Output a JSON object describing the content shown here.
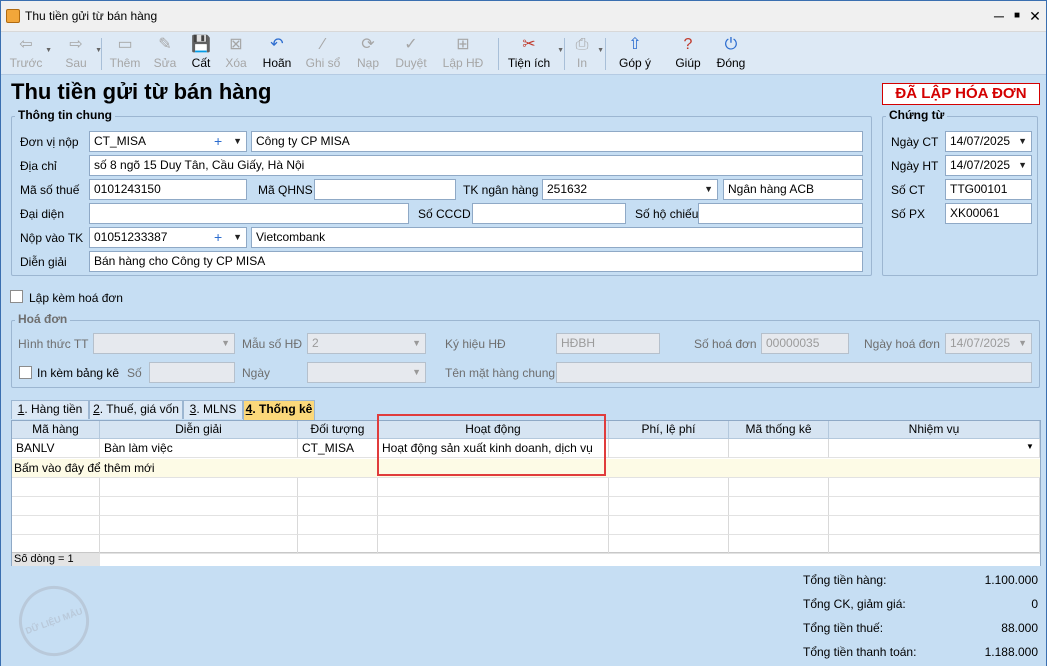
{
  "window": {
    "title": "Thu tiền gửi từ bán hàng",
    "min": "─",
    "max": "■",
    "close": "✕"
  },
  "toolbar": [
    {
      "label": "Trước",
      "icon": "⇦",
      "disabled": true,
      "dropdown": true
    },
    {
      "label": "Sau",
      "icon": "⇨",
      "disabled": true,
      "dropdown": true
    },
    {
      "label": "Thêm",
      "icon": "▭",
      "disabled": true
    },
    {
      "label": "Sửa",
      "icon": "✎",
      "disabled": true
    },
    {
      "label": "Cất",
      "icon": "💾",
      "disabled": false
    },
    {
      "label": "Xóa",
      "icon": "⊠",
      "disabled": true
    },
    {
      "label": "Hoãn",
      "icon": "↶",
      "disabled": false
    },
    {
      "label": "Ghi sổ",
      "icon": "∕",
      "disabled": true
    },
    {
      "label": "Nạp",
      "icon": "⟳",
      "disabled": true
    },
    {
      "label": "Duyệt",
      "icon": "✓",
      "disabled": true
    },
    {
      "label": "Lập HĐ",
      "icon": "⊞",
      "disabled": true
    },
    {
      "label": "Tiện ích",
      "icon": "✂",
      "disabled": false,
      "dropdown": true
    },
    {
      "label": "In",
      "icon": "⎙",
      "disabled": true,
      "dropdown": true
    },
    {
      "label": "Góp ý",
      "icon": "⇧",
      "disabled": false
    },
    {
      "label": "Giúp",
      "icon": "?",
      "disabled": false
    },
    {
      "label": "Đóng",
      "icon": "⏻",
      "disabled": false
    }
  ],
  "page": {
    "heading": "Thu tiền gửi từ bán hàng",
    "status_stamp": "ĐÃ LẬP HÓA ĐƠN"
  },
  "general": {
    "title": "Thông tin chung",
    "payer_label": "Đơn vị nộp",
    "payer_code": "CT_MISA",
    "payer_name": "Công ty CP MISA",
    "address_label": "Địa chỉ",
    "address": "số 8 ngõ 15 Duy Tân, Cầu Giấy, Hà Nội",
    "taxcode_label": "Mã số thuế",
    "taxcode": "0101243150",
    "qhns_label": "Mã QHNS",
    "qhns": "",
    "bankacc_label": "TK ngân hàng",
    "bankacc": "251632",
    "bank_name": "Ngân hàng ACB",
    "rep_label": "Đại diện",
    "rep": "",
    "cccd_label": "Số CCCD",
    "cccd": "",
    "passport_label": "Số hộ chiếu",
    "passport": "",
    "deposit_label": "Nộp vào TK",
    "deposit_acc": "01051233387",
    "deposit_bank": "Vietcombank",
    "desc_label": "Diễn giải",
    "desc": "Bán hàng cho Công ty CP MISA"
  },
  "voucher": {
    "title": "Chứng từ",
    "date_ct_label": "Ngày CT",
    "date_ct": "14/07/2025",
    "date_ht_label": "Ngày HT",
    "date_ht": "14/07/2025",
    "so_ct_label": "Số CT",
    "so_ct": "TTG00101",
    "so_px_label": "Số PX",
    "so_px": "XK00061"
  },
  "invoice_check_label": "Lập kèm hoá đơn",
  "invoice": {
    "title": "Hoá đơn",
    "form_label": "Hình thức TT",
    "form": "",
    "template_label": "Mẫu số HĐ",
    "template": "2",
    "symbol_label": "Ký hiệu HĐ",
    "symbol": "HĐBH",
    "number_label": "Số hoá đơn",
    "number": "00000035",
    "date_label": "Ngày hoá đơn",
    "date": "14/07/2025",
    "attach_label": "In kèm bảng kê",
    "so_label": "Số",
    "so": "",
    "ngay_label": "Ngày",
    "ngay": "",
    "common_name_label": "Tên mặt hàng chung",
    "common_name": ""
  },
  "tabs": [
    {
      "key": "1",
      "label": ". Hàng tiền"
    },
    {
      "key": "2",
      "label": ". Thuế, giá vốn"
    },
    {
      "key": "3",
      "label": ". MLNS"
    },
    {
      "key": "4",
      "label": ". Thống kê"
    }
  ],
  "grid": {
    "columns": [
      "Mã hàng",
      "Diễn giải",
      "Đối tượng",
      "Hoạt động",
      "Phí, lệ phí",
      "Mã thống kê",
      "Nhiệm vụ"
    ],
    "rows": [
      [
        "BANLV",
        "Bàn làm việc",
        "CT_MISA",
        "Hoạt động sản xuất kinh doanh, dịch vụ",
        "",
        "",
        ""
      ]
    ],
    "add_row_text": "Bấm vào đây để thêm mới",
    "row_count": "Số dòng = 1"
  },
  "totals": [
    {
      "label": "Tổng tiền hàng:",
      "value": "1.100.000"
    },
    {
      "label": "Tổng CK, giảm giá:",
      "value": "0"
    },
    {
      "label": "Tổng tiền thuế:",
      "value": "88.000"
    },
    {
      "label": "Tổng tiền thanh toán:",
      "value": "1.188.000"
    }
  ],
  "watermark": "DỮ LIỆU MẪU"
}
